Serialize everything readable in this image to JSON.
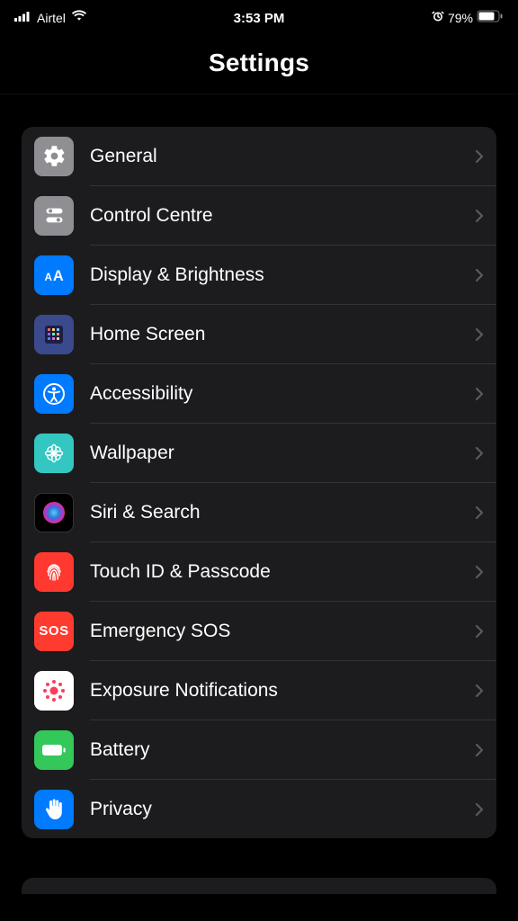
{
  "status": {
    "carrier": "Airtel",
    "time": "3:53 PM",
    "battery_pct": "79%"
  },
  "header": {
    "title": "Settings"
  },
  "settings": {
    "items": [
      {
        "label": "General"
      },
      {
        "label": "Control Centre"
      },
      {
        "label": "Display & Brightness"
      },
      {
        "label": "Home Screen"
      },
      {
        "label": "Accessibility"
      },
      {
        "label": "Wallpaper"
      },
      {
        "label": "Siri & Search"
      },
      {
        "label": "Touch ID & Passcode"
      },
      {
        "label": "Emergency SOS"
      },
      {
        "label": "Exposure Notifications"
      },
      {
        "label": "Battery"
      },
      {
        "label": "Privacy"
      }
    ]
  }
}
